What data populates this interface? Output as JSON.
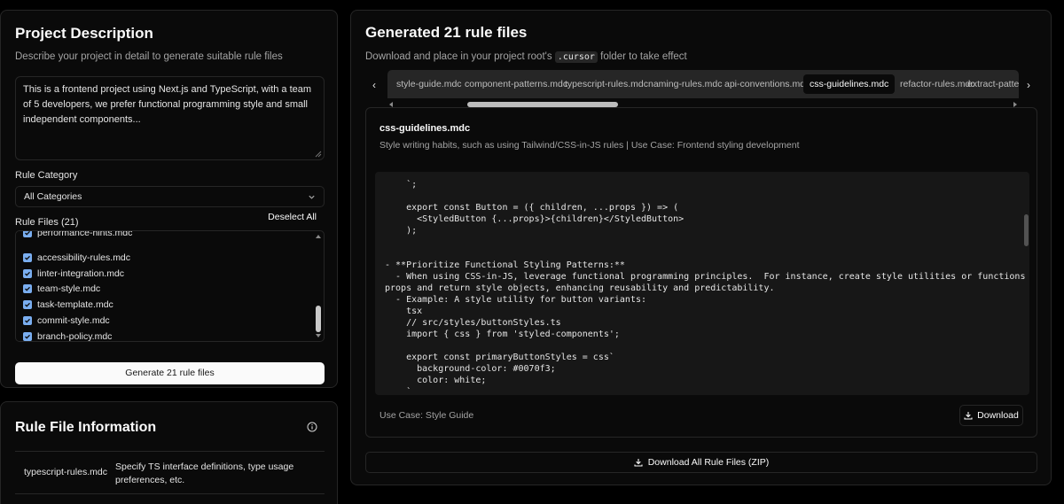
{
  "project": {
    "title": "Project Description",
    "subtitle": "Describe your project in detail to generate suitable rule files",
    "description_value": "This is a frontend project using Next.js and TypeScript, with a team of 5 developers, we prefer functional programming style and small independent components...",
    "category_label": "Rule Category",
    "category_value": "All Categories",
    "files_label": "Rule Files (21)",
    "deselect_label": "Deselect All",
    "files": [
      {
        "label": "performance-hints.mdc",
        "checked": true
      },
      {
        "label": "accessibility-rules.mdc",
        "checked": true
      },
      {
        "label": "linter-integration.mdc",
        "checked": true
      },
      {
        "label": "team-style.mdc",
        "checked": true
      },
      {
        "label": "task-template.mdc",
        "checked": true
      },
      {
        "label": "commit-style.mdc",
        "checked": true
      },
      {
        "label": "branch-policy.mdc",
        "checked": true
      }
    ],
    "generate_label": "Generate 21 rule files"
  },
  "info": {
    "title": "Rule File Information",
    "rows": [
      {
        "name": "typescript-rules.mdc",
        "desc": "Specify TS interface definitions, type usage preferences, etc."
      }
    ]
  },
  "generated": {
    "title": "Generated 21 rule files",
    "subtitle_pre": "Download and place in your project root's",
    "subtitle_code": ".cursor",
    "subtitle_post": "folder to take effect",
    "prev_label": "‹",
    "next_label": "›",
    "tabs": [
      {
        "label": "style-guide.mdc",
        "active": false
      },
      {
        "label": "component-patterns.mdc",
        "active": false
      },
      {
        "label": "typescript-rules.mdc",
        "active": false
      },
      {
        "label": "naming-rules.mdc",
        "active": false
      },
      {
        "label": "api-conventions.mdc",
        "active": false
      },
      {
        "label": "css-guidelines.mdc",
        "active": true
      },
      {
        "label": "refactor-rules.mdc",
        "active": false
      },
      {
        "label": "extract-patterns.mdc",
        "active": false
      }
    ],
    "file": {
      "name": "css-guidelines.mdc",
      "desc": "Style writing habits, such as using Tailwind/CSS-in-JS rules | Use Case: Frontend styling development",
      "code": "    `;\n\n    export const Button = ({ children, ...props }) => (\n      <StyledButton {...props}>{children}</StyledButton>\n    );\n\n\n- **Prioritize Functional Styling Patterns:**\n  - When using CSS-in-JS, leverage functional programming principles.  For instance, create style utilities or functions that accept\nprops and return style objects, enhancing reusability and predictability.\n  - Example: A style utility for button variants:\n    tsx\n    // src/styles/buttonStyles.ts\n    import { css } from 'styled-components';\n\n    export const primaryButtonStyles = css`\n      background-color: #0070f3;\n      color: white;\n    `",
      "use_case": "Use Case: Style Guide",
      "download_label": "Download"
    },
    "download_all_label": "Download All Rule Files (ZIP)"
  }
}
